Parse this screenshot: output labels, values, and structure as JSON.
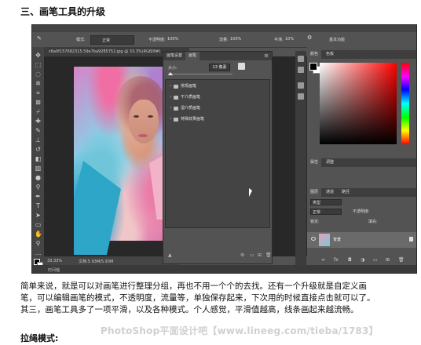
{
  "heading": "三、画笔工具的升级",
  "screenshot": {
    "options_bar": {
      "mode_label": "模式:",
      "mode_value": "正常",
      "opacity_label": "不透明度:",
      "opacity_value": "100%",
      "flow_label": "流量:",
      "flow_value": "100%",
      "smoothing_label": "平滑:",
      "smoothing_value": "10%",
      "workspace_label": "基本功能"
    },
    "document_tab": "c6a0f157682315.59e7ba9285752.jpg @ 33.3%(RGB/8#)",
    "status": {
      "zoom": "33.33%",
      "doc_size": "文档:5.93M/5.93M"
    },
    "timeline_label": "时间轴",
    "brush_panel": {
      "tabs": [
        "画笔设置",
        "画笔"
      ],
      "active_tab": "画笔",
      "size_label": "大小:",
      "size_value": "13 像素",
      "groups": [
        "常规画笔",
        "干介质画笔",
        "湿介质画笔",
        "特殊效果画笔"
      ]
    },
    "color_panel": {
      "tabs": [
        "颜色",
        "色板"
      ],
      "active_tab": "颜色"
    },
    "middle_panel": {
      "tabs": [
        "属性",
        "调整"
      ]
    },
    "layers_panel": {
      "tabs": [
        "图层",
        "通道",
        "路径"
      ],
      "active_tab": "图层",
      "filter_label": "类型",
      "blend_mode": "正常",
      "opacity_label": "不透明度:",
      "lock_label": "锁定:",
      "fill_label": "填充:",
      "layer_name": "背景"
    }
  },
  "paragraph": [
    "简单来说，就是可以对画笔进行整理分组，再也不用一个个的去找。还有一个升级就是自定义画",
    "笔，可以编辑画笔的模式，不透明度，流量等，单独保存起来，下次用的时候直接点击就可以了。",
    "其三，画笔工具多了一项平滑，以及各种模式。个人感觉，平滑值越高，线条画起来越流畅。"
  ],
  "watermark": "PhotoShop平面设计吧【www.lineeg.com/tieba/1783】",
  "sub_heading": "拉绳模式:"
}
